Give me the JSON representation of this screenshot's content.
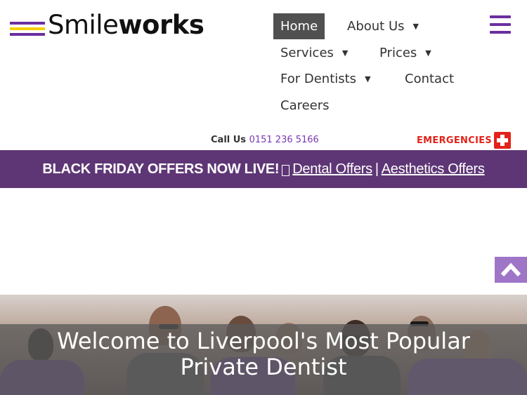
{
  "header": {
    "logo": {
      "name_light": "Smile",
      "name_bold": "works",
      "line_colors": [
        "#6b2fa0",
        "#f5d000",
        "#6b2fa0"
      ]
    },
    "nav": [
      {
        "label": "Home",
        "active": true,
        "has_dropdown": false
      },
      {
        "label": "About Us",
        "active": false,
        "has_dropdown": true
      },
      {
        "label": "Services",
        "active": false,
        "has_dropdown": true
      },
      {
        "label": "Prices",
        "active": false,
        "has_dropdown": true
      },
      {
        "label": "For Dentists",
        "active": false,
        "has_dropdown": true
      },
      {
        "label": "Contact",
        "active": false,
        "has_dropdown": false
      },
      {
        "label": "Careers",
        "active": false,
        "has_dropdown": false
      }
    ],
    "menu_icon": "hamburger-menu-icon",
    "accent_color": "#6b2fa0"
  },
  "contact": {
    "call_label": "Call Us",
    "phone": "0151 236 5166",
    "emergency_label": "EMERGENCIES",
    "emergency_icon": "red-cross-icon",
    "emergency_color": "#e2231a"
  },
  "banner": {
    "headline": "BLACK FRIDAY OFFERS NOW LIVE!",
    "link_dental": "Dental Offers",
    "separator": "|",
    "link_aesthetics": "Aesthetics Offers",
    "background": "#5e3675"
  },
  "back_to_top": {
    "icon": "chevron-up-icon",
    "color": "#9f75c8"
  },
  "hero": {
    "title_line1": "Welcome to Liverpool's Most Popular",
    "title_line2": "Private Dentist"
  }
}
